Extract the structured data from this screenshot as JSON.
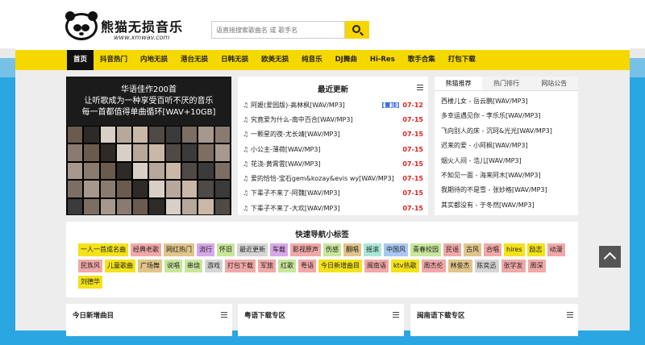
{
  "site": {
    "logo_name": "熊猫无损音乐",
    "logo_url": "www.xmwav.com",
    "search_placeholder": "语直接搜索歌曲名 或 歌手名"
  },
  "nav": [
    "首页",
    "抖音热门",
    "内地无损",
    "港台无损",
    "日韩无损",
    "欧美无损",
    "纯音乐",
    "DJ舞曲",
    "Hi-Res",
    "歌手合集",
    "打包下载"
  ],
  "banner": {
    "lines": [
      "华语佳作200首",
      "让听歌成为一种享受百听不厌的音乐",
      "每一首都值得单曲循环[WAV+10GB]"
    ]
  },
  "latest": {
    "title": "最近更新",
    "songs": [
      {
        "title": "阿嬷(爱园版)-高林枫[WAV/MP3]",
        "tag": "[置顶]",
        "date": "07-12"
      },
      {
        "title": "究竟爱为什么-南中百合[WAV/MP3]",
        "tag": "",
        "date": "07-15"
      },
      {
        "title": "一颗星的夜-尤长靖[WAV/MP3]",
        "tag": "",
        "date": "07-15"
      },
      {
        "title": "小公主-薄荷[WAV/MP3]",
        "tag": "",
        "date": "07-15"
      },
      {
        "title": "花浇-黄霄雲[WAV/MP3]",
        "tag": "",
        "date": "07-15"
      },
      {
        "title": "爱的恰恰-宝石gem&kozay&evis wy[WAV/MP3]",
        "tag": "",
        "date": "07-15"
      },
      {
        "title": "下辈子不来了-阿魏[WAV/MP3]",
        "tag": "",
        "date": "07-15"
      },
      {
        "title": "下辈子不来了-大欢[WAV/MP3]",
        "tag": "",
        "date": "07-15"
      }
    ]
  },
  "recommend": {
    "tabs": [
      "熊猫推荐",
      "热门排行",
      "网站公告"
    ],
    "items": [
      "西楼儿女 - 岳云鹏[WAV/MP3]",
      "多幸运遇见你 - 李乐乐[WAV/MP3]",
      "飞向别人的床 - 沉珂&光光[WAV/MP3]",
      "迟来的爱 - 小阿枫[WAV/MP3]",
      "烟火人间 - 浩儿[WAV/MP3]",
      "不知见一面 - 海来阿木[WAV/MP3]",
      "我期待的不是雪 - 张妙格[WAV/MP3]",
      "其实都没有 - 于冬然[WAV/MP3]"
    ]
  },
  "tagpanel": {
    "title": "快速导航小标签",
    "tags": [
      {
        "label": "一人一首成名曲",
        "color": "#f4e21a"
      },
      {
        "label": "经典老歌",
        "color": "#f2a8a8"
      },
      {
        "label": "网红热门",
        "color": "#e0c48a"
      },
      {
        "label": "流行",
        "color": "#d7a8e8"
      },
      {
        "label": "怀旧",
        "color": "#c7e69a"
      },
      {
        "label": "最近更新",
        "color": "#d5d5d5"
      },
      {
        "label": "车载",
        "color": "#d7a8e8"
      },
      {
        "label": "影视原声",
        "color": "#f2a8a8"
      },
      {
        "label": "伤感",
        "color": "#c7e69a"
      },
      {
        "label": "翻唱",
        "color": "#e0c48a"
      },
      {
        "label": "摇滚",
        "color": "#a8e8d8"
      },
      {
        "label": "中国风",
        "color": "#a8c8f2"
      },
      {
        "label": "青春校园",
        "color": "#c7e69a"
      },
      {
        "label": "民谣",
        "color": "#f2a8a8"
      },
      {
        "label": "古风",
        "color": "#e0c48a"
      },
      {
        "label": "合唱",
        "color": "#f2a8a8"
      },
      {
        "label": "hires",
        "color": "#f4e21a"
      },
      {
        "label": "励志",
        "color": "#f4e21a"
      },
      {
        "label": "动漫",
        "color": "#f2a8a8"
      },
      {
        "label": "民族风",
        "color": "#f2a8a8"
      },
      {
        "label": "儿童歌曲",
        "color": "#f4e21a"
      },
      {
        "label": "广场舞",
        "color": "#e0c48a"
      },
      {
        "label": "说唱",
        "color": "#c7e69a"
      },
      {
        "label": "串烧",
        "color": "#c7e69a"
      },
      {
        "label": "游戏",
        "color": "#d5d5d5"
      },
      {
        "label": "打包下载",
        "color": "#f2a8a8"
      },
      {
        "label": "军旅",
        "color": "#f2a8a8"
      },
      {
        "label": "红歌",
        "color": "#c7e69a"
      },
      {
        "label": "粤语",
        "color": "#f2a8a8"
      },
      {
        "label": "今日新增曲目",
        "color": "#f4e21a"
      },
      {
        "label": "闽南语",
        "color": "#f2a8a8"
      },
      {
        "label": "ktv热歌",
        "color": "#f4e21a"
      },
      {
        "label": "周杰伦",
        "color": "#f2a8a8"
      },
      {
        "label": "林俊杰",
        "color": "#e0c48a"
      },
      {
        "label": "陈奕迅",
        "color": "#d5d5d5"
      },
      {
        "label": "张学友",
        "color": "#f2a8a8"
      },
      {
        "label": "周深",
        "color": "#f2a8a8"
      },
      {
        "label": "刘德华",
        "color": "#f4e21a"
      }
    ]
  },
  "bottom": {
    "today": "今日新增曲目",
    "cantonese": "粤语下载专区",
    "minnan": "闽南语下载专区"
  }
}
